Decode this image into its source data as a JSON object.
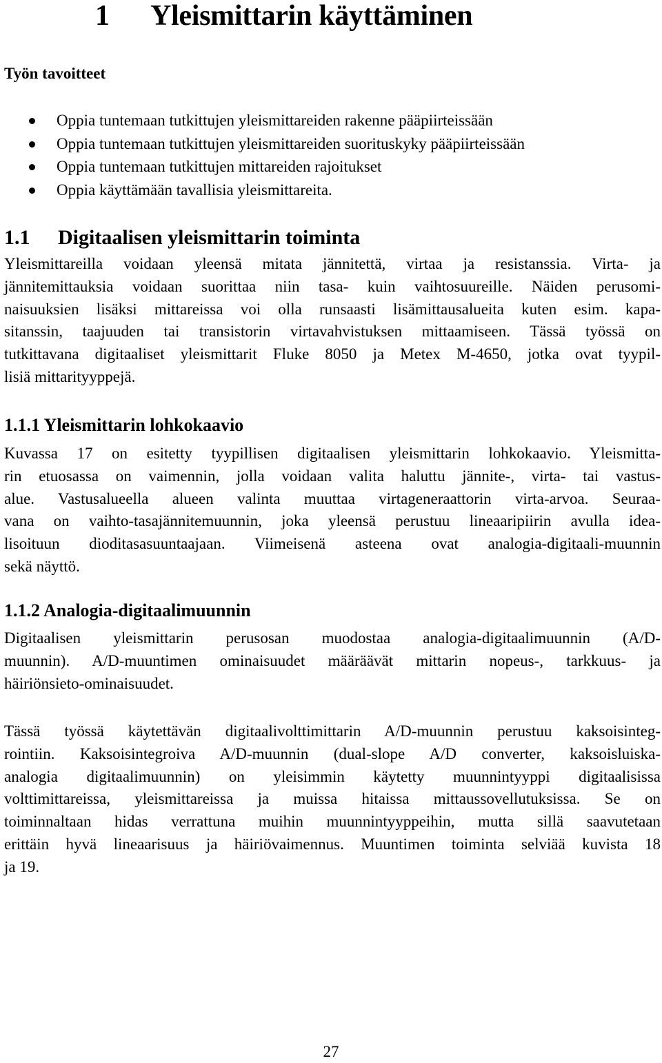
{
  "chapter": {
    "number": "1",
    "title": "Yleismittarin käyttäminen"
  },
  "goals": {
    "heading": "Työn tavoitteet",
    "items": [
      "Oppia tuntemaan tutkittujen yleismittareiden rakenne pääpiirteissään",
      "Oppia tuntemaan tutkittujen yleismittareiden suorituskyky  pääpiirteissään",
      "Oppia tuntemaan tutkittujen mittareiden rajoitukset",
      "Oppia käyttämään tavallisia yleismittareita."
    ]
  },
  "section_1_1": {
    "number": "1.1",
    "title": "Digitaalisen yleismittarin toiminta",
    "paragraph_lines": [
      "Yleismittareilla voidaan yleensä mitata jännitettä, virtaa ja resistanssia. Virta- ja",
      "jännitemittauksia voidaan suorittaa niin tasa- kuin vaihtosuureille. Näiden perusomi-",
      "naisuuksien lisäksi mittareissa voi olla runsaasti lisämittausalueita kuten esim. kapa-",
      "sitanssin, taajuuden tai transistorin virtavahvistuksen mittaamiseen. Tässä työssä on",
      "tutkittavana digitaaliset yleismittarit Fluke 8050 ja Metex M-4650, jotka ovat tyypil-",
      "lisiä mittarityyppejä."
    ]
  },
  "section_1_1_1": {
    "number": "1.1.1",
    "title": "Yleismittarin lohkokaavio",
    "paragraph_lines": [
      "Kuvassa 17 on esitetty tyypillisen digitaalisen yleismittarin lohkokaavio. Yleismitta-",
      "rin etuosassa on vaimennin,  jolla voidaan valita haluttu jännite-, virta- tai vastus-",
      "alue. Vastusalueella alueen valinta muuttaa virtageneraattorin virta-arvoa. Seuraa-",
      "vana on vaihto-tasajännitemuunnin, joka yleensä perustuu lineaaripiirin avulla idea-",
      "lisoituun dioditasasuuntaajaan. Viimeisenä asteena ovat analogia-digitaali-muunnin",
      "sekä näyttö."
    ]
  },
  "section_1_1_2": {
    "number": "1.1.2",
    "title": "Analogia-digitaalimuunnin",
    "paragraph1_lines": [
      "Digitaalisen yleismittarin perusosan muodostaa analogia-digitaalimuunnin (A/D-",
      "muunnin). A/D-muuntimen ominaisuudet määräävät mittarin nopeus-, tarkkuus- ja",
      "häiriönsieto-ominaisuudet."
    ],
    "paragraph2_lines": [
      "Tässä työssä käytettävän digitaalivolttimittarin A/D-muunnin perustuu kaksoisinteg-",
      "rointiin. Kaksoisintegroiva A/D-muunnin (dual-slope A/D converter, kaksoisluiska-",
      "analogia digitaalimuunnin) on yleisimmin käytetty muunnintyyppi digitaalisissa",
      "volttimittareissa, yleismittareissa ja muissa hitaissa mittaussovellutuksissa. Se on",
      "toiminnaltaan hidas verrattuna muihin muunnintyyppeihin, mutta sillä saavutetaan",
      "erittäin hyvä lineaarisuus ja häiriövaimennus. Muuntimen toiminta selviää kuvista 18",
      "ja 19."
    ]
  },
  "footer": {
    "page_number": "27"
  }
}
